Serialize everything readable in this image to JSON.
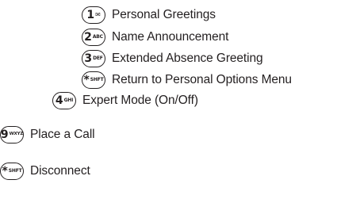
{
  "items": [
    {
      "key_main": "1",
      "key_sub": "✉",
      "label": "Personal Greetings"
    },
    {
      "key_main": "2",
      "key_sub": "ABC",
      "label": "Name Announcement"
    },
    {
      "key_main": "3",
      "key_sub": "DEF",
      "label": "Extended Absence Greeting"
    },
    {
      "key_main": "*",
      "key_sub": "SHFT",
      "label": "Return to Personal Options Menu"
    },
    {
      "key_main": "4",
      "key_sub": "GHI",
      "label": "Expert Mode (On/Off)"
    },
    {
      "key_main": "9",
      "key_sub": "WXYZ",
      "label": "Place a Call"
    },
    {
      "key_main": "*",
      "key_sub": "SHFT",
      "label": "Disconnect"
    }
  ]
}
